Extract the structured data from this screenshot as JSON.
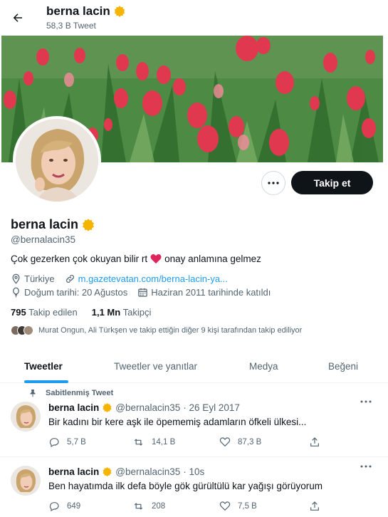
{
  "header": {
    "name": "berna lacin",
    "tweet_count": "58,3 B Tweet"
  },
  "profile": {
    "name": "berna lacin",
    "handle": "@bernalacin35",
    "bio_before": "Çok gezerken çok okuyan bilir rt",
    "bio_after": "onay anlamına gelmez",
    "location": "Türkiye",
    "website": "m.gazetevatan.com/berna-lacin-ya...",
    "birthday": "Doğum tarihi: 20 Ağustos",
    "joined": "Haziran 2011 tarihinde katıldı",
    "following_count": "795",
    "following_label": "Takip edilen",
    "followers_count": "1,1 Mn",
    "followers_label": "Takipçi",
    "known_followers": "Murat Ongun, Ali Türkşen ve takip ettiğin diğer 9 kişi tarafından takip ediliyor",
    "follow_button": "Takip et"
  },
  "tabs": [
    {
      "label": "Tweetler",
      "active": true
    },
    {
      "label": "Tweetler ve yanıtlar",
      "active": false
    },
    {
      "label": "Medya",
      "active": false
    },
    {
      "label": "Beğeni",
      "active": false
    }
  ],
  "tweets": [
    {
      "pinned_label": "Sabitlenmiş Tweet",
      "name": "berna lacin",
      "handle": "@bernalacin35",
      "time": "· 26 Eyl 2017",
      "text": "Bir kadını bir kere aşk ile öpememiş adamların öfkeli ülkesi...",
      "replies": "5,7 B",
      "retweets": "14,1 B",
      "likes": "87,3 B"
    },
    {
      "name": "berna lacin",
      "handle": "@bernalacin35",
      "time": "· 10s",
      "text": "Ben hayatımda ilk defa böyle gök gürültülü kar yağışı görüyorum",
      "replies": "649",
      "retweets": "208",
      "likes": "7,5 B"
    }
  ],
  "colors": {
    "accent": "#1d9bf0",
    "text": "#0f1419",
    "secondary": "#536471",
    "verified_badge": "#f4b400",
    "heart": "#e0245e"
  },
  "icons": [
    "back-arrow-icon",
    "verified-badge-icon",
    "more-icon",
    "heart-emoji-icon",
    "location-icon",
    "link-icon",
    "balloon-icon",
    "calendar-icon",
    "pin-icon",
    "reply-icon",
    "retweet-icon",
    "like-icon",
    "share-icon"
  ]
}
